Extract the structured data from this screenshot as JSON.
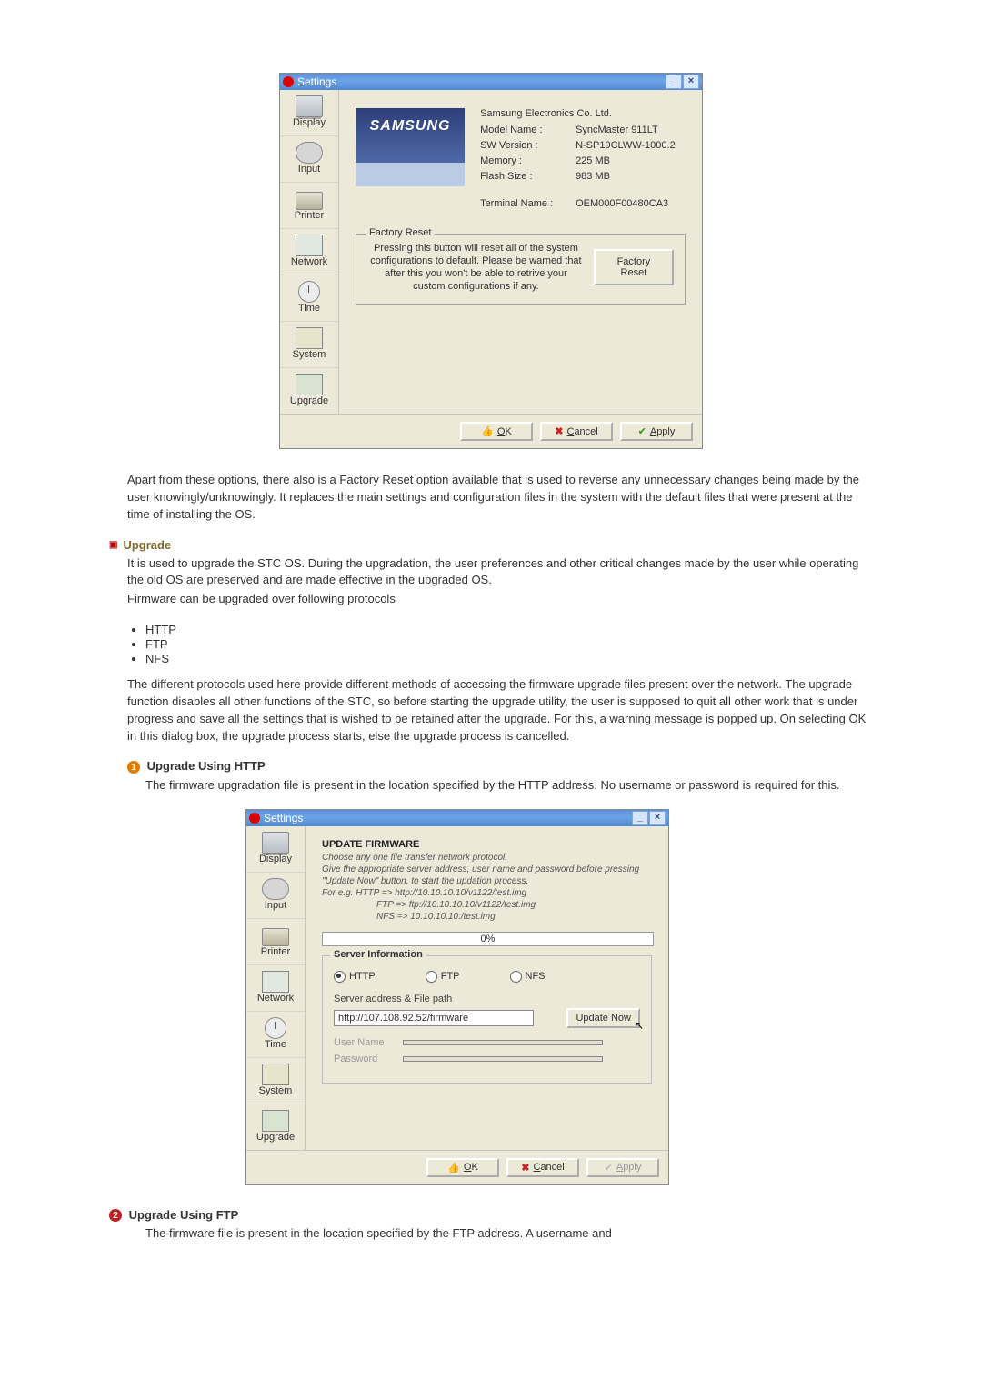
{
  "dlg1": {
    "title": "Settings",
    "sidebar": [
      "Display",
      "Input",
      "Printer",
      "Network",
      "Time",
      "System",
      "Upgrade"
    ],
    "company": "Samsung Electronics Co. Ltd.",
    "model_label": "Model Name :",
    "model_value": "SyncMaster 911LT",
    "sw_label": "SW Version :",
    "sw_value": "N-SP19CLWW-1000.2",
    "mem_label": "Memory :",
    "mem_value": "225 MB",
    "flash_label": "Flash Size :",
    "flash_value": "983 MB",
    "term_label": "Terminal Name :",
    "term_value": "OEM000F00480CA3",
    "samsung_logo": "SAMSUNG",
    "factory_reset_legend": "Factory Reset",
    "factory_reset_msg": "Pressing this button will reset all of the system configurations to default. Please be warned that after this you won't be able to retrive your custom configurations if any.",
    "factory_reset_btn": "Factory Reset",
    "ok": "OK",
    "cancel": "Cancel",
    "apply": "Apply"
  },
  "para1": "Apart from these options, there also is a Factory Reset option available that is used to reverse any unnecessary changes being made by the user knowingly/unknowingly. It replaces the main settings and configuration files in the system with the default files that were present at the time of installing the OS.",
  "upgrade_heading": "Upgrade",
  "para2": "It is used to upgrade the STC OS. During the upgradation, the user preferences and other  critical changes made by the user while operating the old OS are preserved and are made effective in the upgraded OS.",
  "para2b": "Firmware can be upgraded over following protocols",
  "protocols": [
    "HTTP",
    "FTP",
    "NFS"
  ],
  "para3": "The different protocols used here provide different methods of accessing the firmware upgrade files present over the network. The upgrade function disables all other functions of the STC, so before starting the upgrade utility, the user is supposed to quit all other work that is under progress and save all the settings that is wished to be retained after the upgrade. For this, a warning message is popped up. On selecting OK in this dialog box, the upgrade process starts, else the upgrade process is cancelled.",
  "http_title": "Upgrade Using HTTP",
  "http_desc": "The firmware upgradation file is present in the location specified by the HTTP address. No username or password is required for this.",
  "dlg2": {
    "title": "Settings",
    "sidebar": [
      "Display",
      "Input",
      "Printer",
      "Network",
      "Time",
      "System",
      "Upgrade"
    ],
    "update_head": "UPDATE FIRMWARE",
    "update_desc_l1": "Choose any one file transfer network protocol.",
    "update_desc_l2": "Give the appropriate server address, user name and password before pressing \"Update Now\" button, to start the updation process.",
    "update_desc_l3": "For e.g.    HTTP => http://10.10.10.10/v1122/test.img",
    "update_desc_l4": "FTP => ftp://10.10.10.10/v1122/test.img",
    "update_desc_l5": "NFS => 10.10.10.10:/test.img",
    "progress": "0%",
    "server_info": "Server Information",
    "radio_http": "HTTP",
    "radio_ftp": "FTP",
    "radio_nfs": "NFS",
    "addr_label": "Server address & File path",
    "addr_value": "http://107.108.92.52/firmware",
    "update_now": "Update Now",
    "user_label": "User Name",
    "pass_label": "Password",
    "ok": "OK",
    "cancel": "Cancel",
    "apply": "Apply"
  },
  "ftp_title": "Upgrade Using FTP",
  "ftp_desc": "The firmware file is present in the location specified by the FTP address. A username and"
}
